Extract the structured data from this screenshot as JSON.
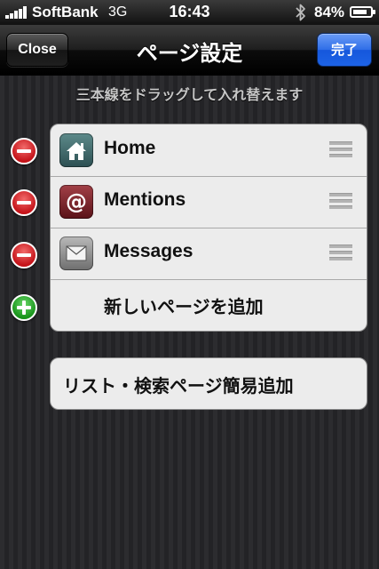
{
  "status_bar": {
    "carrier": "SoftBank",
    "network": "3G",
    "time": "16:43",
    "battery": "84%",
    "battery_level": 0.84,
    "bluetooth_icon": "bluetooth-icon"
  },
  "nav": {
    "title": "ページ設定",
    "close_label": "Close",
    "done_label": "完了",
    "done_color": "#1d63e6"
  },
  "hint": "三本線をドラッグして入れ替えます",
  "pages": [
    {
      "label": "Home",
      "icon": "home-icon",
      "control": "remove"
    },
    {
      "label": "Mentions",
      "icon": "at-sign-icon",
      "control": "remove"
    },
    {
      "label": "Messages",
      "icon": "envelope-icon",
      "control": "remove"
    }
  ],
  "add_page_label": "新しいページを追加",
  "list_search_label": "リスト・検索ページ簡易追加",
  "colors": {
    "remove": "#c5141a",
    "insert": "#18941a"
  }
}
